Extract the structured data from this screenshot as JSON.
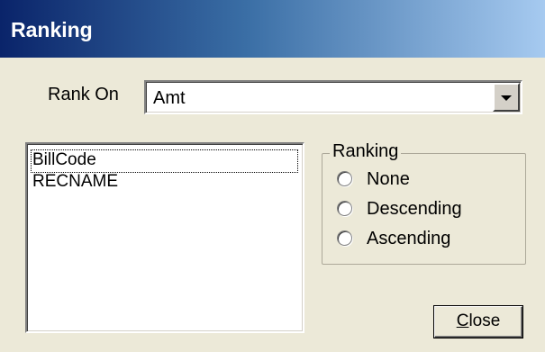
{
  "window": {
    "title": "Ranking"
  },
  "rank_on": {
    "label": "Rank On",
    "selected": "Amt"
  },
  "fields_list": {
    "items": [
      "BillCode",
      "RECNAME"
    ]
  },
  "ranking_group": {
    "legend": "Ranking",
    "options": [
      "None",
      "Descending",
      "Ascending"
    ]
  },
  "buttons": {
    "close_mnemonic": "C",
    "close_rest": "lose"
  }
}
